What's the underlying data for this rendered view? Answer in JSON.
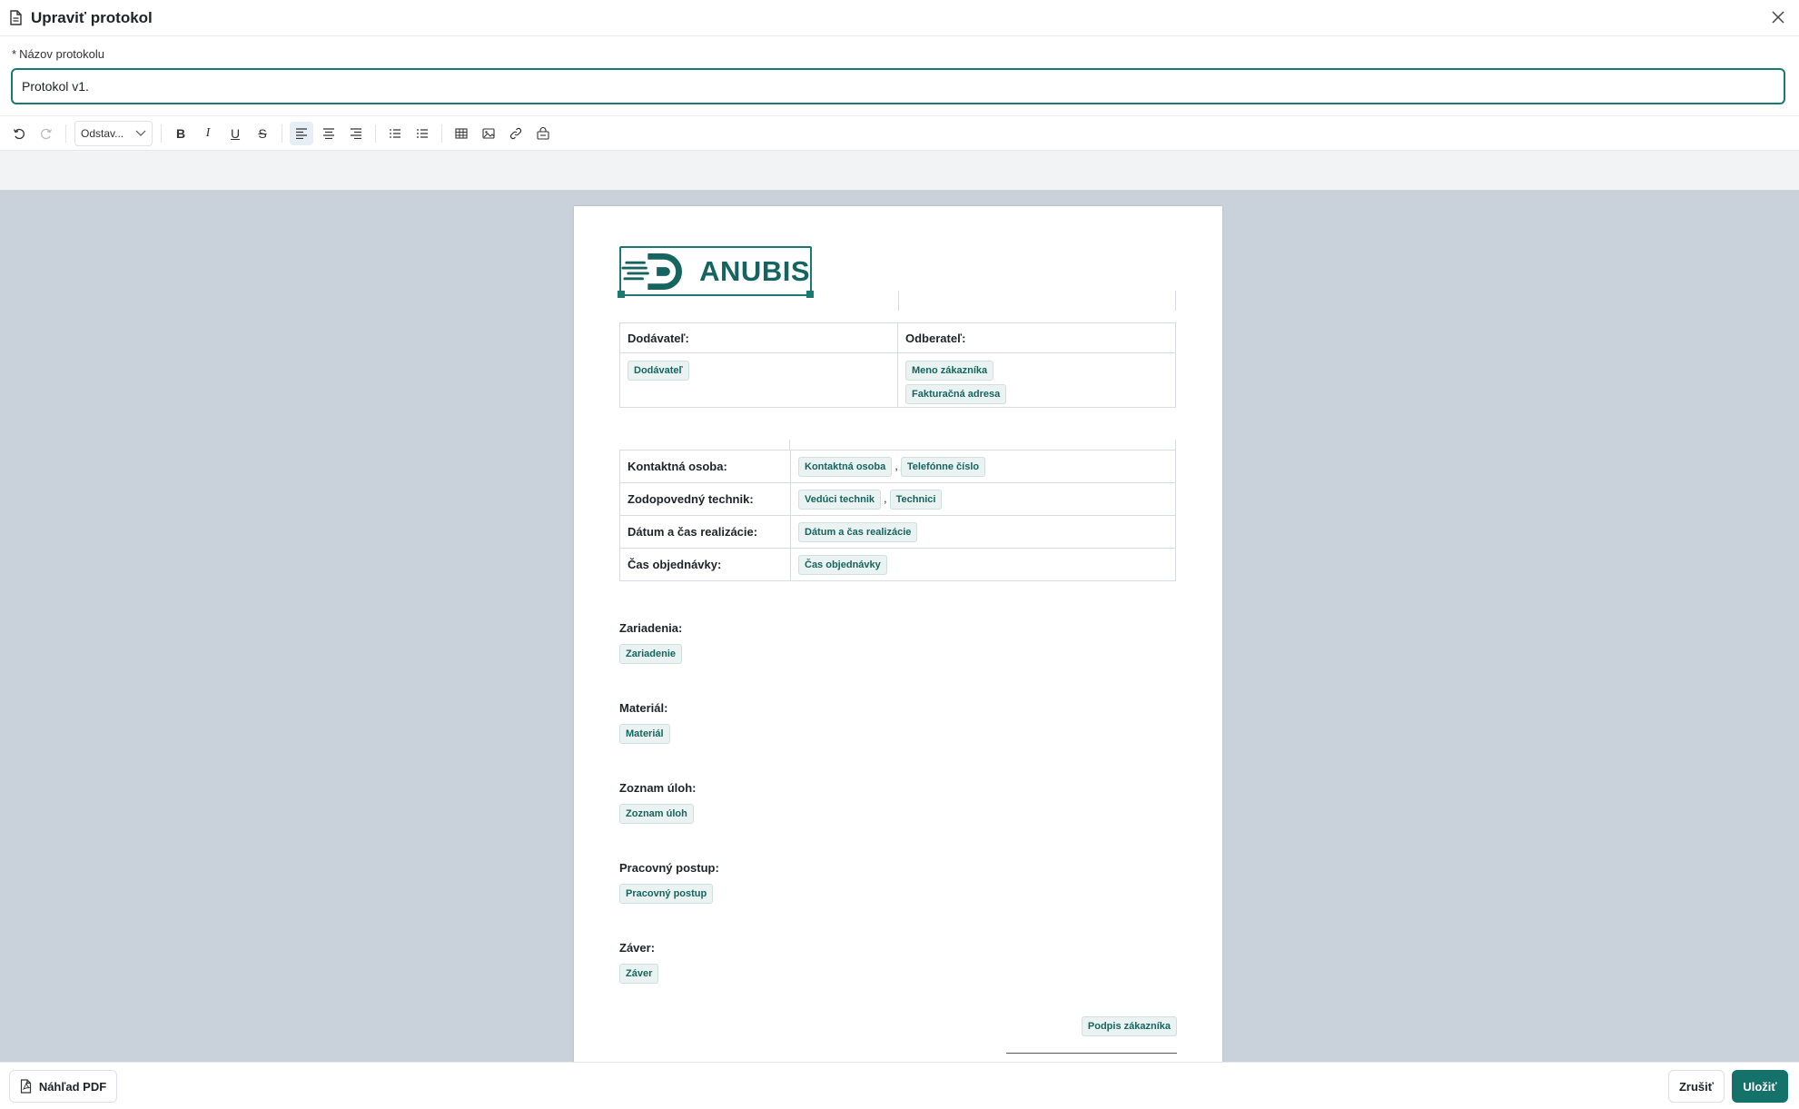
{
  "header": {
    "title": "Upraviť protokol"
  },
  "name_field": {
    "label": "Názov protokolu",
    "required_mark": "*",
    "value": "Protokol v1."
  },
  "toolbar": {
    "paragraph_style": "Odstav..."
  },
  "document": {
    "logo_text": "ANUBIS",
    "parties": {
      "supplier_label": "Dodávateľ:",
      "customer_label": "Odberateľ:",
      "supplier_tags": [
        "Dodávateľ"
      ],
      "customer_tags": [
        "Meno zákazníka",
        "Fakturačná adresa"
      ]
    },
    "info_rows": [
      {
        "label": "Kontaktná osoba:",
        "tags": [
          "Kontaktná osoba",
          "Telefónne číslo"
        ]
      },
      {
        "label": "Zodopovedný technik:",
        "tags": [
          "Vedúci technik",
          "Technici"
        ]
      },
      {
        "label": "Dátum a čas realizácie:",
        "tags": [
          "Dátum a čas realizácie"
        ]
      },
      {
        "label": "Čas objednávky:",
        "tags": [
          "Čas objednávky"
        ]
      }
    ],
    "sections": [
      {
        "title": "Zariadenia:",
        "tag": "Zariadenie"
      },
      {
        "title": "Materiál:",
        "tag": "Materiál"
      },
      {
        "title": "Zoznam úloh:",
        "tag": "Zoznam úloh"
      },
      {
        "title": "Pracovný postup:",
        "tag": "Pracovný postup"
      },
      {
        "title": "Záver:",
        "tag": "Záver"
      }
    ],
    "signature_tag": "Podpis zákazníka"
  },
  "footer": {
    "preview_label": "Náhľad PDF",
    "cancel_label": "Zrušiť",
    "save_label": "Uložiť"
  },
  "colors": {
    "accent": "#14726a",
    "editor_bg": "#c9d1da",
    "tag_bg": "#eaf3f2"
  }
}
